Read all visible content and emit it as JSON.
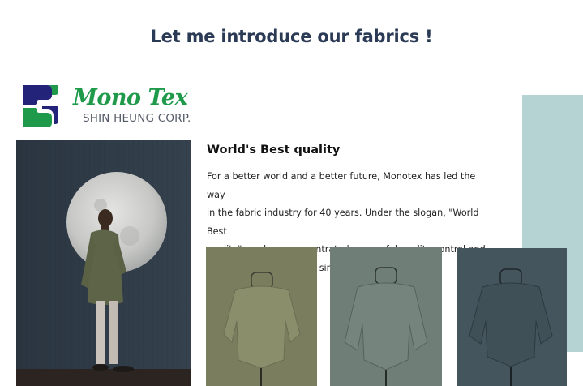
{
  "page": {
    "heading": "Let me introduce our fabrics !"
  },
  "logo": {
    "brand": "Mono Tex",
    "company": "SHIN HEUNG CORP."
  },
  "section": {
    "title": "World's Best quality",
    "lines": [
      "For a better world and a better future, Monotex has led the way",
      "in the fabric industry for 40 years. Under the slogan, \"World Best",
      "quality\", we have concentrated on careful quality control and",
      "new development items since 1973."
    ]
  },
  "colors": {
    "heading": "#2b3a55",
    "brand_green": "#1f9a4a",
    "brand_navy": "#23237a",
    "teal_panel": "#b5d3d2",
    "fabric_olive": "#7f8362",
    "fabric_sage": "#6f7f78",
    "fabric_slate": "#44555e"
  },
  "images": {
    "hero": "model-with-moon-photo",
    "fabrics": [
      "olive-fabric-top-on-mannequin",
      "sage-fabric-top-on-mannequin",
      "slate-fabric-top-on-mannequin"
    ]
  }
}
